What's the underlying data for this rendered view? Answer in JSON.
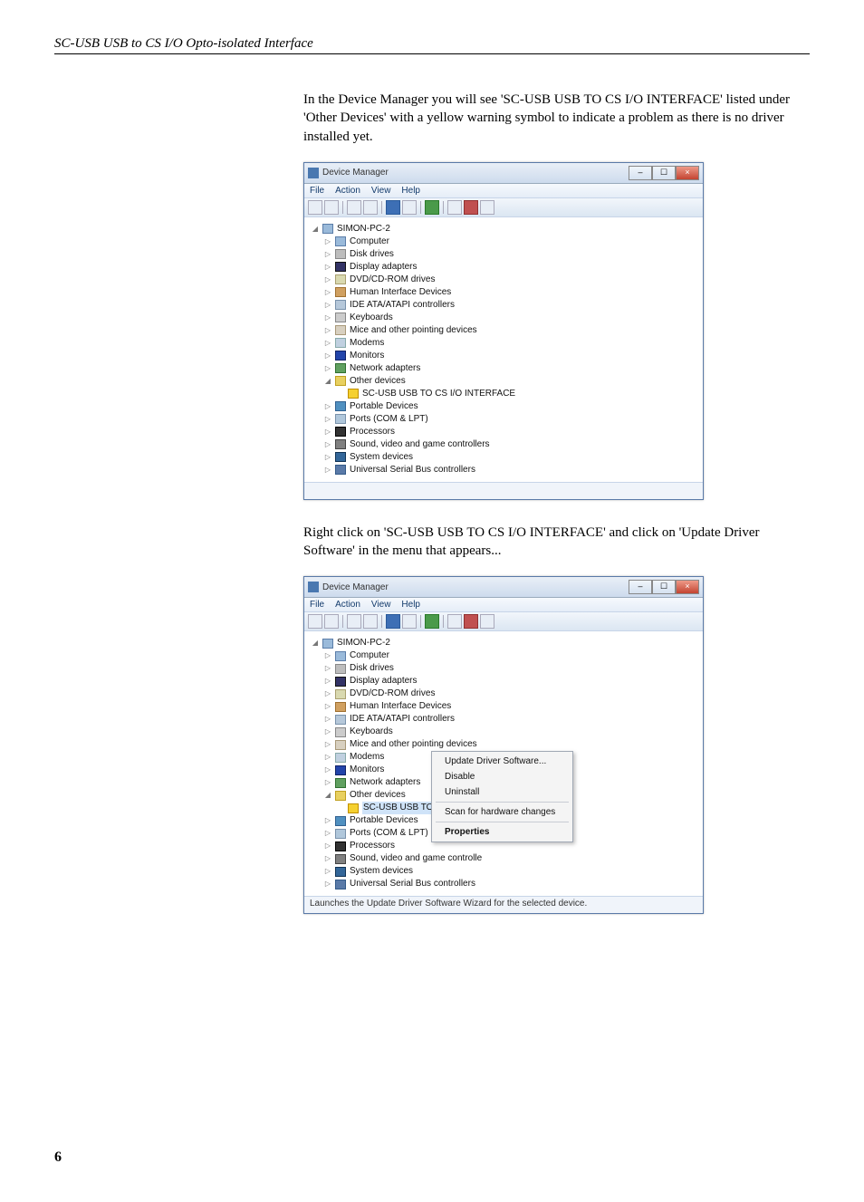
{
  "doc": {
    "header": "SC-USB USB to CS I/O Opto-isolated Interface",
    "para1": "In the Device Manager you will see 'SC-USB USB TO CS I/O INTERFACE' listed under 'Other Devices' with a yellow warning symbol to indicate a problem as there is no driver installed yet.",
    "para2": "Right click on 'SC-USB USB TO CS I/O INTERFACE' and click on 'Update Driver Software' in the menu that appears...",
    "page_number": "6"
  },
  "dm": {
    "title": "Device Manager",
    "menus": {
      "file": "File",
      "action": "Action",
      "view": "View",
      "help": "Help"
    },
    "root": "SIMON-PC-2",
    "nodes": {
      "computer": "Computer",
      "disk": "Disk drives",
      "display": "Display adapters",
      "dvd": "DVD/CD-ROM drives",
      "hid": "Human Interface Devices",
      "ide": "IDE ATA/ATAPI controllers",
      "keyboards": "Keyboards",
      "mice": "Mice and other pointing devices",
      "modems": "Modems",
      "monitors": "Monitors",
      "network": "Network adapters",
      "other": "Other devices",
      "scusb": "SC-USB  USB TO CS I/O INTERFACE",
      "scusb_short": "SC-USB  USB TO CS I/O INTER",
      "portable": "Portable Devices",
      "ports": "Ports (COM & LPT)",
      "processors": "Processors",
      "sound": "Sound, video and game controllers",
      "sound_short": "Sound, video and game controlle",
      "system": "System devices",
      "usb": "Universal Serial Bus controllers"
    },
    "status2": "Launches the Update Driver Software Wizard for the selected device."
  },
  "context_menu": {
    "update": "Update Driver Software...",
    "disable": "Disable",
    "uninstall": "Uninstall",
    "scan": "Scan for hardware changes",
    "properties": "Properties"
  }
}
